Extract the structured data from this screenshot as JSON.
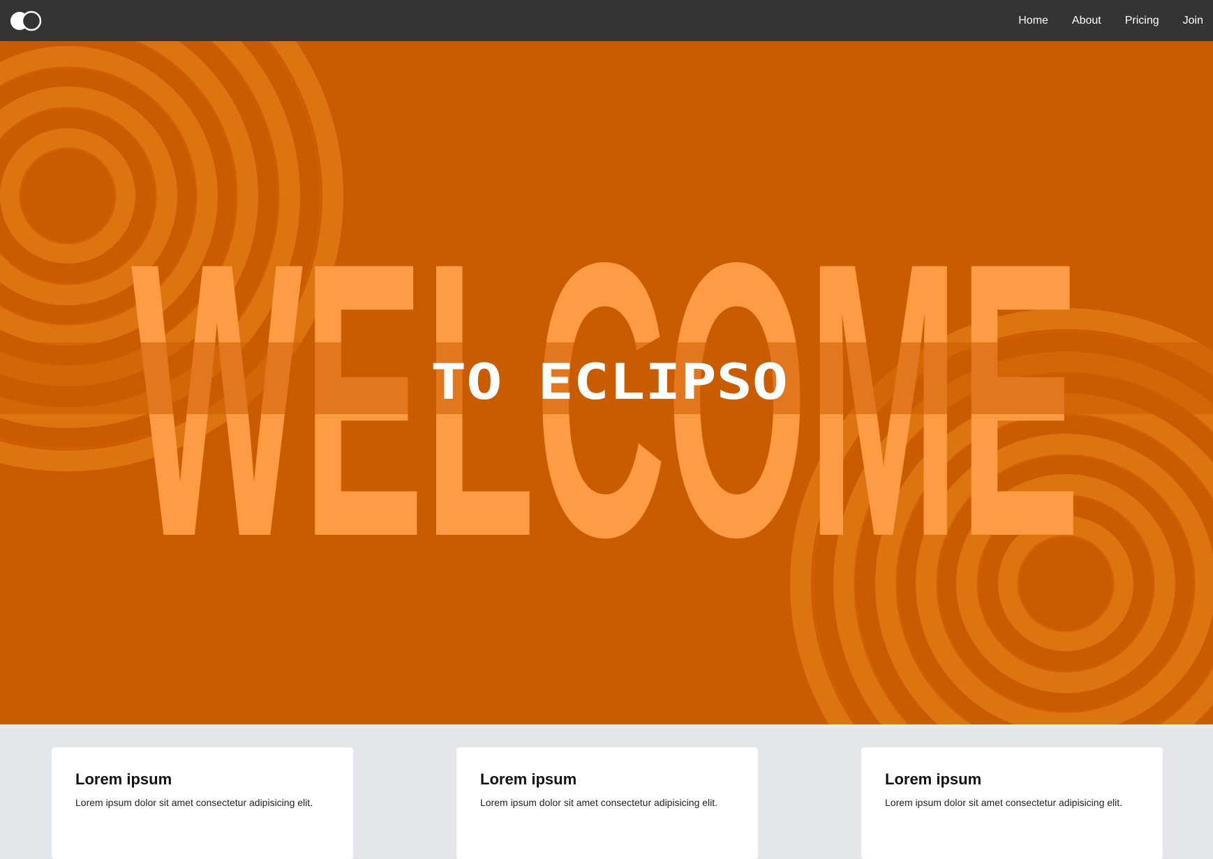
{
  "navbar": {
    "logo_icon": "eclipse-logo-icon",
    "links": [
      {
        "label": "Home"
      },
      {
        "label": "About"
      },
      {
        "label": "Pricing"
      },
      {
        "label": "Join"
      }
    ]
  },
  "hero": {
    "background_word": "WELCOME",
    "tagline": "TO ECLIPSO",
    "colors": {
      "background": "#c95b00",
      "word": "#ff9a45",
      "rings": "#e07a12",
      "band": "#d46a0a",
      "tagline": "#ffffff"
    }
  },
  "cards": [
    {
      "title": "Lorem ipsum",
      "text": "Lorem ipsum dolor sit amet consectetur adipisicing elit."
    },
    {
      "title": "Lorem ipsum",
      "text": "Lorem ipsum dolor sit amet consectetur adipisicing elit."
    },
    {
      "title": "Lorem ipsum",
      "text": "Lorem ipsum dolor sit amet consectetur adipisicing elit."
    }
  ]
}
